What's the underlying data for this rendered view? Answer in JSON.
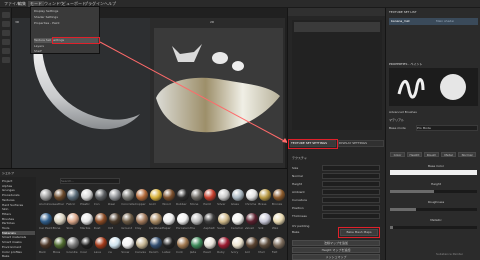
{
  "menubar": {
    "items": [
      "ファイル",
      "編集",
      "モード",
      "ウィンドウ",
      "ビューポート",
      "プラグイン",
      "ヘルプ"
    ]
  },
  "dropdown": {
    "items": [
      "Display Settings",
      "Shader Settings",
      "Properties - Paint",
      "Texture Set Settings",
      "Layers",
      "Shelf",
      "UV"
    ],
    "highlight_index": 3
  },
  "viewport": {
    "title_3d": "3D",
    "title_2d": "2D"
  },
  "texture_set_list": {
    "title": "TEXTURE SET LIST",
    "item": "banana_mat",
    "shader": "Main shader"
  },
  "layers": {
    "tab_active": "TEXTURE SET SETTINGS",
    "tab_other": "DISPLAY SETTINGS",
    "section": "テクスチャ",
    "rows": [
      "Size",
      "Normal",
      "Height",
      "Ambient",
      "Curvature",
      "Position",
      "Thickness"
    ],
    "normal_mix_label": "Normal mixing",
    "ao_label": "AO mixing",
    "uv_padding_label": "UV padding",
    "bake_label": "Bake",
    "bake_button": "Bake Mesh Maps",
    "button_a": "法線マップを追加",
    "button_b": "Height マップを追加",
    "button_c": "メッシュマップ"
  },
  "properties": {
    "title": "PROPERTIES - ペイント",
    "section_brush": "Advanced Brushes",
    "section_material": "マテリアル",
    "mode_label": "Base mode",
    "mode_value": "Pro Mode",
    "channel_buttons": [
      "Color",
      "Height",
      "Rough",
      "Metal",
      "Normal"
    ],
    "param_labels": [
      "Base Color",
      "Height",
      "Roughness",
      "Metallic"
    ],
    "param_values": [
      "0.5",
      "0.0",
      "0.3",
      "0.0"
    ],
    "footer": "Substance Painter"
  },
  "shelf": {
    "tab": "シェルフ",
    "categories": [
      "Project",
      "Alphas",
      "Grunges",
      "Procedurals",
      "Textures",
      "Hard Surfaces",
      "Skin",
      "Filters",
      "Brushes",
      "Particles",
      "Tools",
      "Materials",
      "Smart materials",
      "Smart masks",
      "Environment",
      "Color profiles",
      "Bake"
    ],
    "selected_category": "Materials",
    "search_placeholder": "Search...",
    "materials_row1": [
      "Aluminium",
      "Leather",
      "Fabric",
      "Plastic",
      "Iron",
      "Steel",
      "Concrete",
      "Copper",
      "Gold",
      "Wood",
      "Rubber",
      "Stone",
      "Paint",
      "Silver",
      "Glass",
      "Chrome",
      "Brass",
      "Bronze"
    ],
    "materials_row2": [
      "Car Paint",
      "Bone",
      "Skin",
      "Marble",
      "Rust",
      "Dirt",
      "Ground",
      "Clay",
      "Cardboard",
      "Paper",
      "Porcelain",
      "Tile",
      "Asphalt",
      "Sand",
      "Ceramic",
      "Velvet",
      "Silk",
      "Wax"
    ],
    "materials_row3": [
      "Bark",
      "Moss",
      "Granite",
      "Coal",
      "Lava",
      "Ice",
      "Snow",
      "Canvas",
      "Denim",
      "Latex",
      "Cork",
      "Jade",
      "Pearl",
      "Ruby",
      "Ivory",
      "Soil",
      "Mud",
      "Felt"
    ],
    "colors_row1": [
      "#9a9a9a",
      "#6b4a2b",
      "#5a6b78",
      "#d7d7d7",
      "#5c5f62",
      "#8f9296",
      "#7a7a75",
      "#b36a3a",
      "#d8b13a",
      "#7b4f2c",
      "#2b2b2b",
      "#6e6a64",
      "#c63f2d",
      "#c9c9c9",
      "#aab8c2",
      "#e2e2e2",
      "#b99a45",
      "#8b5a2b"
    ],
    "colors_row2": [
      "#2f5d8a",
      "#d9d2c0",
      "#d9a689",
      "#e6e6e6",
      "#8a4a24",
      "#4a3a2a",
      "#6b5a44",
      "#a0785a",
      "#a88a64",
      "#eeeeee",
      "#f0f0f0",
      "#bcbcbc",
      "#3c3c3c",
      "#cfb98a",
      "#f2f2ee",
      "#5a1f2d",
      "#c8c8d8",
      "#e8d9b0"
    ],
    "colors_row3": [
      "#4a3526",
      "#4f6a2f",
      "#7a7a7a",
      "#1e1e1e",
      "#a33a1a",
      "#cfe3ee",
      "#f4f4f4",
      "#c5b593",
      "#334e70",
      "#222222",
      "#a07850",
      "#3e8a5a",
      "#e7e3da",
      "#9b1b30",
      "#ece4cf",
      "#5b4431",
      "#5a4a3a",
      "#7a6a5a"
    ]
  },
  "accent": "#e0202a"
}
